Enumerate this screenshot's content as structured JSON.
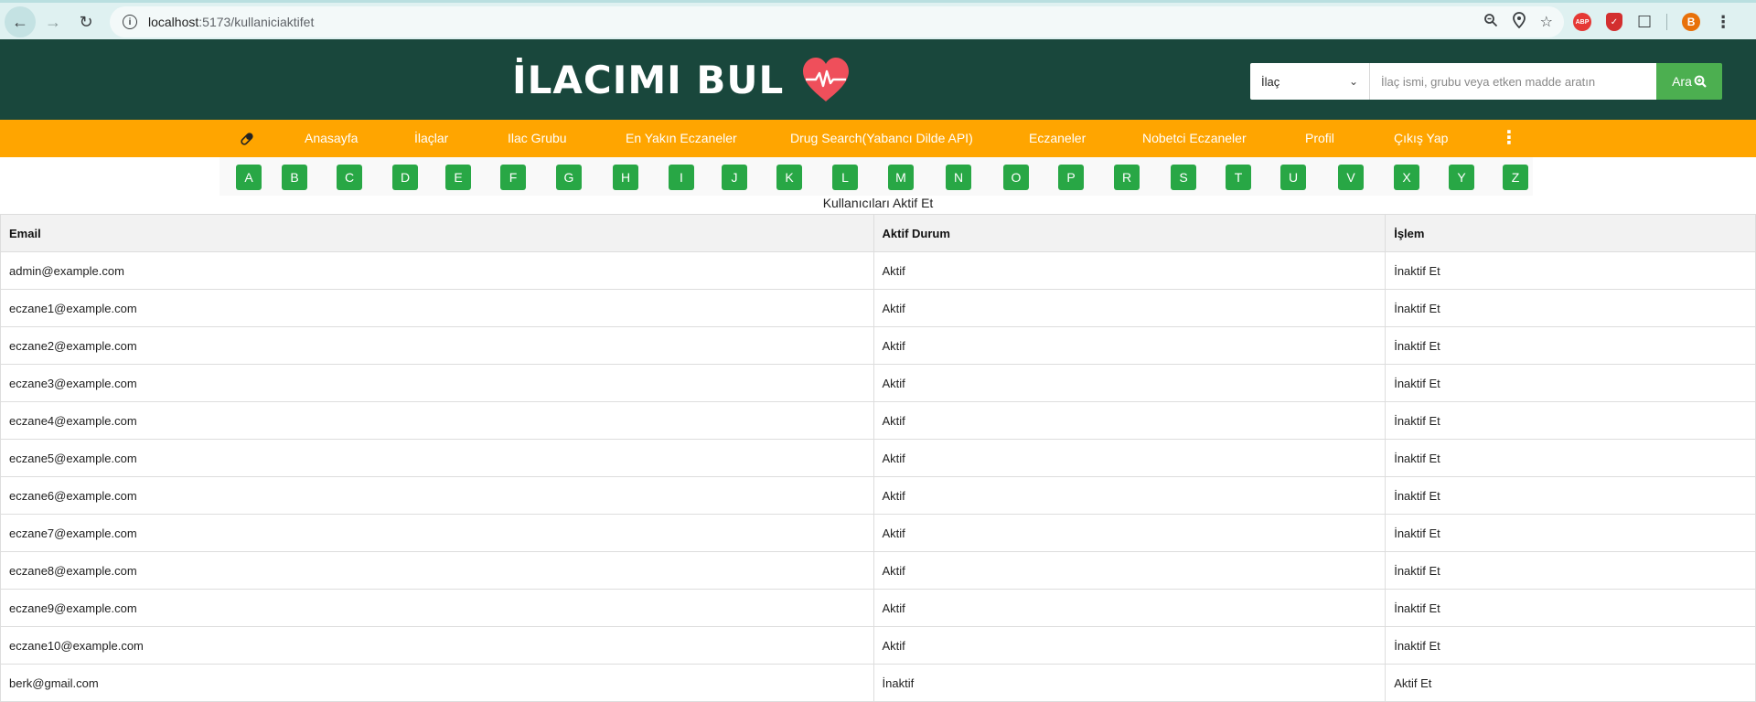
{
  "browser": {
    "url_host": "localhost",
    "url_rest": ":5173/kullaniciaktifet",
    "profile_initial": "B",
    "abp_label": "ABP"
  },
  "header": {
    "title": "İLACIMI BUL",
    "search": {
      "category": "İlaç",
      "placeholder": "İlaç ismi, grubu veya etken madde aratın",
      "button_label": "Ara"
    }
  },
  "menu": {
    "items": [
      {
        "label": "Anasayfa"
      },
      {
        "label": "İlaçlar"
      },
      {
        "label": "Ilac Grubu"
      },
      {
        "label": "En Yakın Eczaneler"
      },
      {
        "label": "Drug Search(Yabancı Dilde API)"
      },
      {
        "label": "Eczaneler"
      },
      {
        "label": "Nobetci Eczaneler"
      },
      {
        "label": "Profil"
      },
      {
        "label": "Çıkış Yap"
      }
    ]
  },
  "alphabet": [
    "A",
    "B",
    "C",
    "D",
    "E",
    "F",
    "G",
    "H",
    "I",
    "J",
    "K",
    "L",
    "M",
    "N",
    "O",
    "P",
    "R",
    "S",
    "T",
    "U",
    "V",
    "X",
    "Y",
    "Z"
  ],
  "page": {
    "title": "Kullanıcıları Aktif Et"
  },
  "table": {
    "headers": [
      "Email",
      "Aktif Durum",
      "İşlem"
    ],
    "rows": [
      {
        "email": "admin@example.com",
        "status": "Aktif",
        "action": "İnaktif Et"
      },
      {
        "email": "eczane1@example.com",
        "status": "Aktif",
        "action": "İnaktif Et"
      },
      {
        "email": "eczane2@example.com",
        "status": "Aktif",
        "action": "İnaktif Et"
      },
      {
        "email": "eczane3@example.com",
        "status": "Aktif",
        "action": "İnaktif Et"
      },
      {
        "email": "eczane4@example.com",
        "status": "Aktif",
        "action": "İnaktif Et"
      },
      {
        "email": "eczane5@example.com",
        "status": "Aktif",
        "action": "İnaktif Et"
      },
      {
        "email": "eczane6@example.com",
        "status": "Aktif",
        "action": "İnaktif Et"
      },
      {
        "email": "eczane7@example.com",
        "status": "Aktif",
        "action": "İnaktif Et"
      },
      {
        "email": "eczane8@example.com",
        "status": "Aktif",
        "action": "İnaktif Et"
      },
      {
        "email": "eczane9@example.com",
        "status": "Aktif",
        "action": "İnaktif Et"
      },
      {
        "email": "eczane10@example.com",
        "status": "Aktif",
        "action": "İnaktif Et"
      },
      {
        "email": "berk@gmail.com",
        "status": "İnaktif",
        "action": "Aktif Et"
      }
    ]
  },
  "colors": {
    "header_bg": "#19473c",
    "menu_bg": "#ffa500",
    "letter_bg": "#28a745",
    "search_button": "#4caf50",
    "heart": "#ef4f5b"
  },
  "icons": {
    "menu_leading": "pill-icon",
    "brand": "heart-pulse-icon",
    "search_button": "search-plus-icon"
  }
}
